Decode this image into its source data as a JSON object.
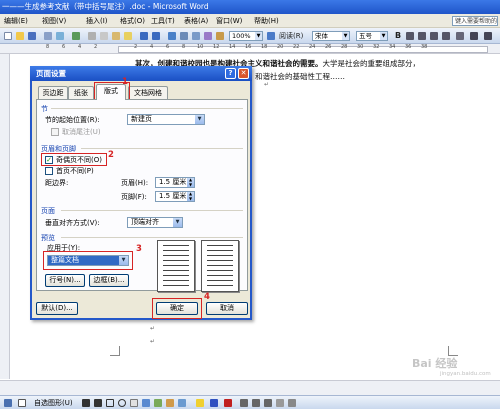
{
  "window": {
    "title": "一——生成参考文献（带中括号尾注）.doc - Microsoft Word"
  },
  "menubar": {
    "items": [
      "编辑(E)",
      "视图(V)",
      "插入(I)",
      "格式(O)",
      "工具(T)",
      "表格(A)",
      "窗口(W)",
      "帮助(H)"
    ],
    "help_search_placeholder": "键入需要帮助的问题"
  },
  "toolbar": {
    "zoom": "100%",
    "read_label": "阅读(R)",
    "font_name": "宋体",
    "font_size": "五号",
    "bold": "B"
  },
  "ruler": {
    "numbers": [
      "8",
      "6",
      "4",
      "2",
      "2",
      "4",
      "6",
      "8",
      "10",
      "12",
      "14",
      "16",
      "18",
      "20",
      "22",
      "24",
      "26",
      "28",
      "30",
      "32",
      "34",
      "36",
      "38"
    ]
  },
  "document": {
    "line1_bold": "其次，创建和谐校园也是构建社会主义和谐社会的需要。",
    "line1_rest": "大学是社会的重要组成部分，",
    "line2": "和谐社会的基础性工程",
    "line2_suffix": "……",
    "para_mark": "↵"
  },
  "dialog": {
    "title": "页面设置",
    "help_icon_glyph": "?",
    "close_icon_glyph": "✕",
    "tabs": [
      "页边距",
      "纸张",
      "版式",
      "文档网格"
    ],
    "active_tab": "版式",
    "section_group": "节",
    "section_start_label": "节的起始位置(R):",
    "section_start_value": "新建页",
    "suppress_endnotes": "取消尾注(U)",
    "headers_group": "页眉和页脚",
    "odd_even_label": "奇偶页不同(O)",
    "odd_even_checked": true,
    "first_page_label": "首页不同(P)",
    "first_page_checked": false,
    "from_edge_label": "距边界:",
    "header_label": "页眉(H):",
    "header_value": "1.5 厘米",
    "footer_label": "页脚(F):",
    "footer_value": "1.5 厘米",
    "page_group": "页面",
    "valign_label": "垂直对齐方式(V):",
    "valign_value": "顶端对齐",
    "preview_group": "预览",
    "apply_to_label": "应用于(Y):",
    "apply_to_value": "整篇文档",
    "line_numbers_button": "行号(N)...",
    "borders_button": "边框(B)...",
    "default_button": "默认(D)...",
    "ok_button": "确定",
    "cancel_button": "取消",
    "annotations": [
      "1",
      "2",
      "3",
      "4"
    ]
  },
  "drawbar": {
    "label": "自选图形(U)"
  },
  "watermark": {
    "text": "Bai 经验",
    "sub": "jingyan.baidu.com"
  },
  "colors": {
    "annotation_red": "#d62525",
    "titlebar_blue": "#1f55c9",
    "dialog_face": "#ece9d8"
  }
}
